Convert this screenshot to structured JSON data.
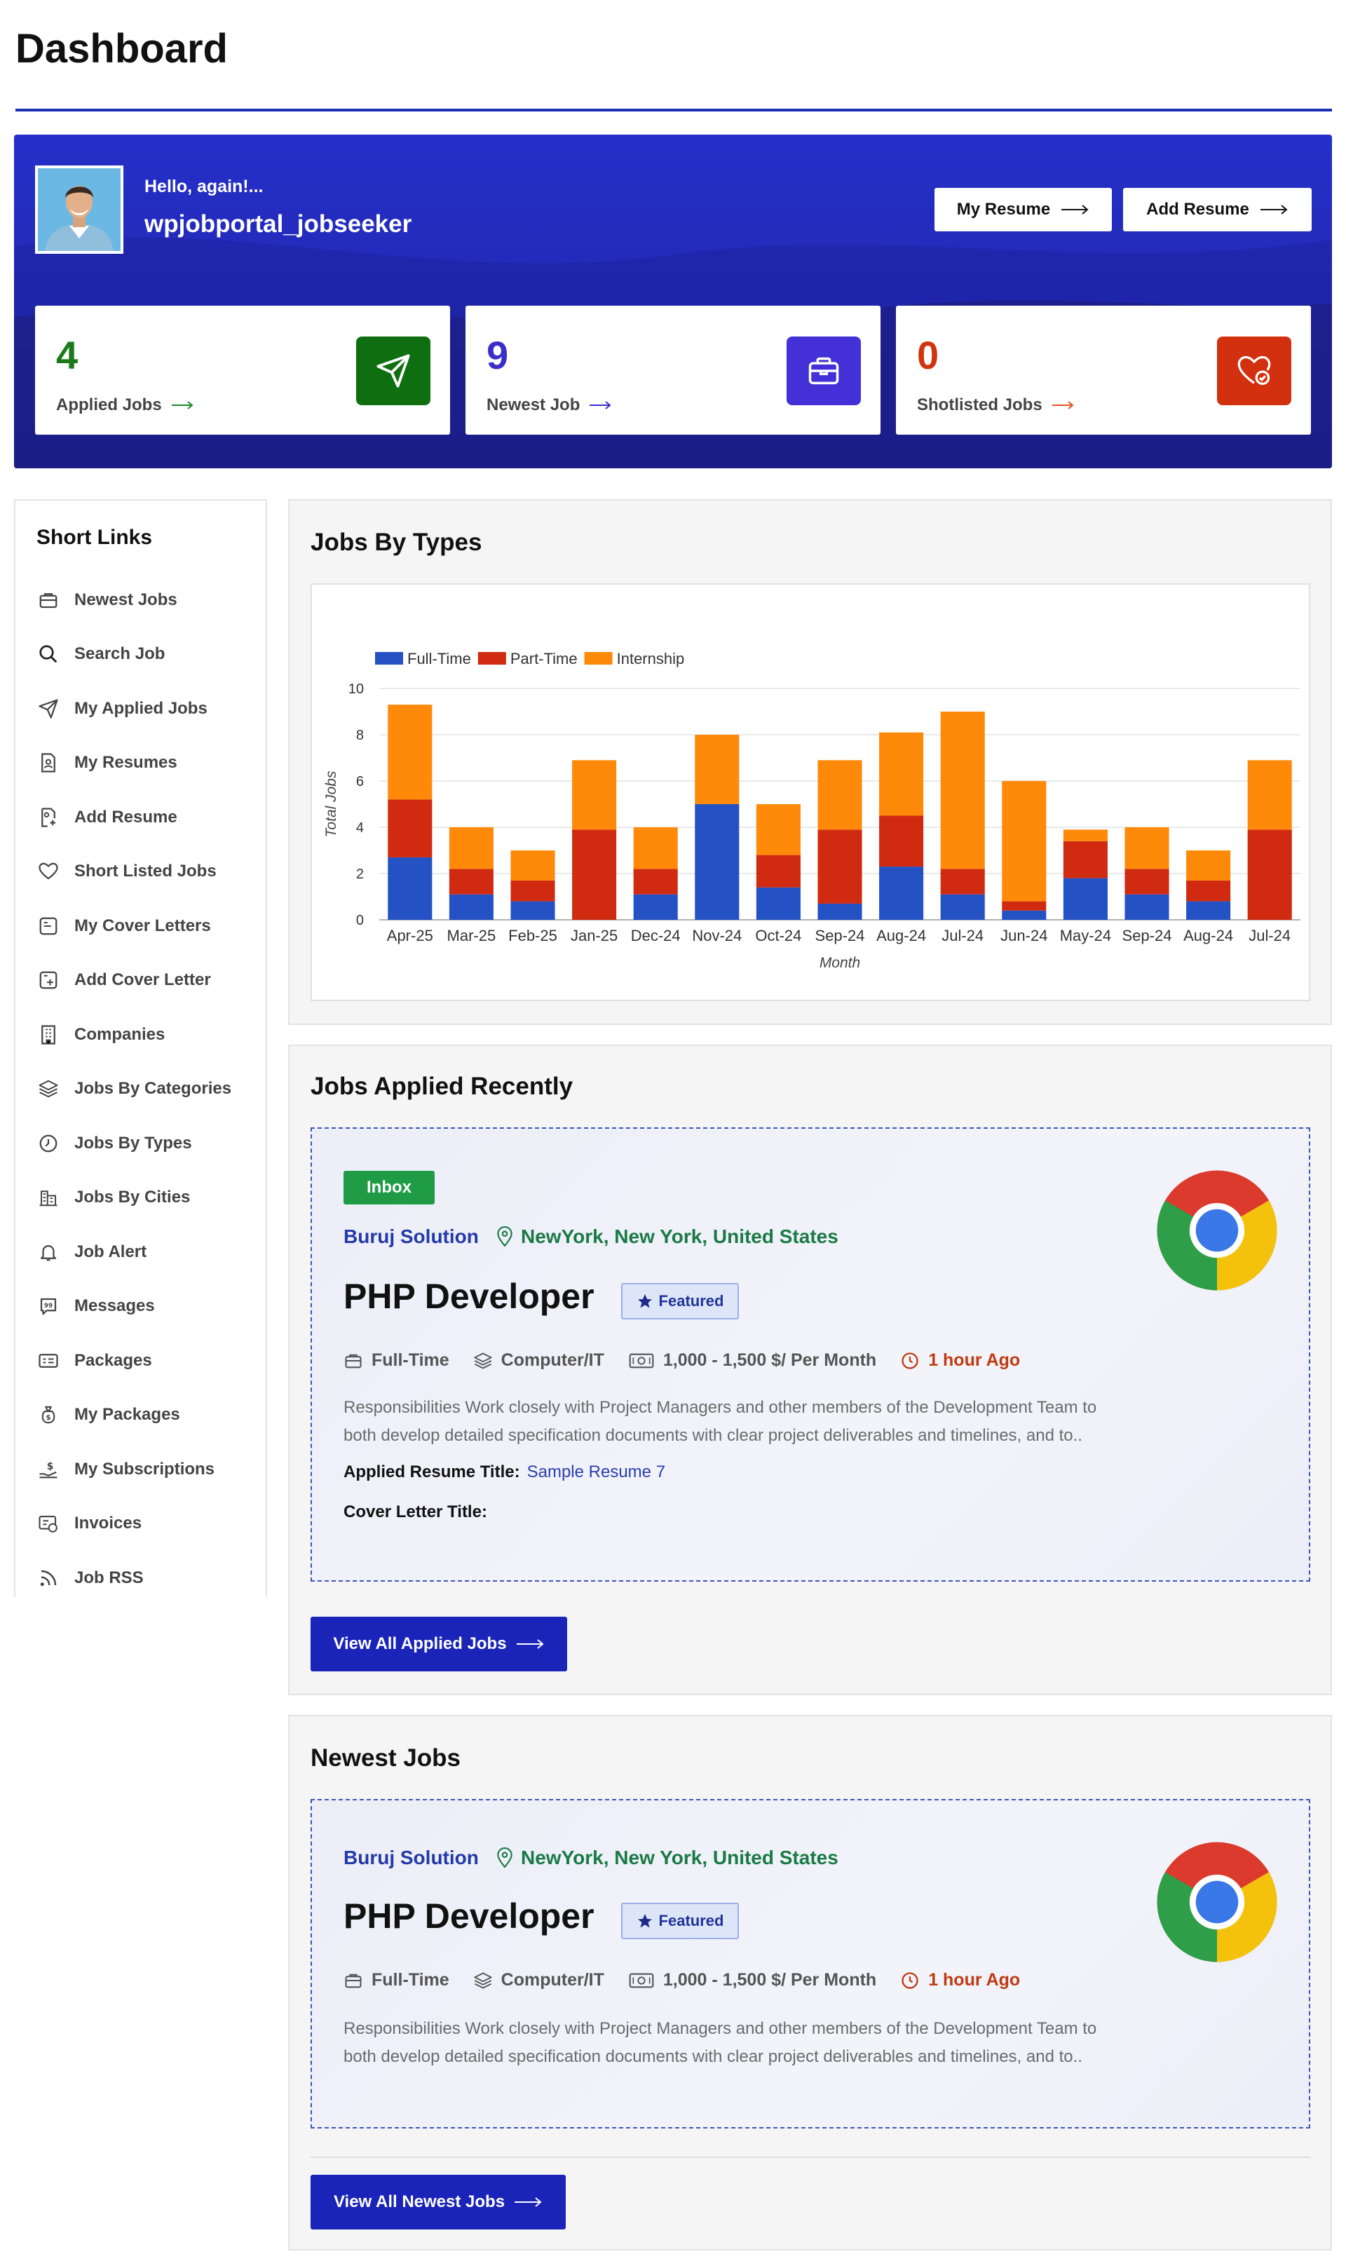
{
  "page": {
    "title": "Dashboard"
  },
  "hero": {
    "greeting": "Hello, again!...",
    "username": "wpjobportal_jobseeker",
    "buttons": {
      "my_resume": "My Resume",
      "add_resume": "Add Resume"
    },
    "stats": [
      {
        "value": "4",
        "label": "Applied Jobs",
        "color": "#1a7a1a",
        "icon": "paper-plane-icon",
        "icon_bg": "#0f6e0f"
      },
      {
        "value": "9",
        "label": "Newest Job",
        "color": "#3a2fc9",
        "icon": "briefcase-icon",
        "icon_bg": "#4330d6"
      },
      {
        "value": "0",
        "label": "Shotlisted Jobs",
        "color": "#d1350f",
        "icon": "heart-check-icon",
        "icon_bg": "#d2300e"
      }
    ]
  },
  "sidebar": {
    "title": "Short Links",
    "items": [
      {
        "label": "Newest Jobs",
        "icon": "briefcase-icon"
      },
      {
        "label": "Search Job",
        "icon": "search-icon"
      },
      {
        "label": "My Applied Jobs",
        "icon": "paper-plane-icon"
      },
      {
        "label": "My Resumes",
        "icon": "resume-icon"
      },
      {
        "label": "Add Resume",
        "icon": "add-resume-icon"
      },
      {
        "label": "Short Listed Jobs",
        "icon": "heart-icon"
      },
      {
        "label": "My Cover Letters",
        "icon": "cover-letter-icon"
      },
      {
        "label": "Add Cover Letter",
        "icon": "add-cover-letter-icon"
      },
      {
        "label": "Companies",
        "icon": "building-icon"
      },
      {
        "label": "Jobs By Categories",
        "icon": "layers-icon"
      },
      {
        "label": "Jobs By Types",
        "icon": "clock-icon"
      },
      {
        "label": "Jobs By Cities",
        "icon": "city-icon"
      },
      {
        "label": "Job Alert",
        "icon": "bell-icon"
      },
      {
        "label": "Messages",
        "icon": "message-icon"
      },
      {
        "label": "Packages",
        "icon": "package-icon"
      },
      {
        "label": "My Packages",
        "icon": "money-bag-icon"
      },
      {
        "label": "My Subscriptions",
        "icon": "subscription-icon"
      },
      {
        "label": "Invoices",
        "icon": "invoice-icon"
      },
      {
        "label": "Job RSS",
        "icon": "rss-icon"
      }
    ]
  },
  "jobs_by_types": {
    "title": "Jobs By Types"
  },
  "chart_data": {
    "type": "bar",
    "stacked": true,
    "categories": [
      "Apr-25",
      "Mar-25",
      "Feb-25",
      "Jan-25",
      "Dec-24",
      "Nov-24",
      "Oct-24",
      "Sep-24",
      "Aug-24",
      "Jul-24",
      "Jun-24",
      "May-24",
      "Sep-24",
      "Aug-24",
      "Jul-24"
    ],
    "series": [
      {
        "name": "Full-Time",
        "color": "#2451c4",
        "values": [
          2.7,
          1.1,
          0.8,
          0,
          1.1,
          5,
          1.4,
          0.7,
          2.3,
          1.1,
          0.4,
          1.8,
          1.1,
          0.8,
          0
        ]
      },
      {
        "name": "Part-Time",
        "color": "#d02a10",
        "values": [
          2.5,
          1.1,
          0.9,
          3.9,
          1.1,
          0,
          1.4,
          3.2,
          2.2,
          1.1,
          0.4,
          1.6,
          1.1,
          0.9,
          3.9
        ]
      },
      {
        "name": "Internship",
        "color": "#ff8a0a",
        "values": [
          4.1,
          1.8,
          1.3,
          3,
          1.8,
          3,
          2.2,
          3,
          3.6,
          6.8,
          5.2,
          0.5,
          1.8,
          1.3,
          3
        ]
      }
    ],
    "ylabel": "Total Jobs",
    "xlabel": "Month",
    "ylim": [
      0,
      10
    ],
    "yticks": [
      0,
      2,
      4,
      6,
      8,
      10
    ],
    "grid": true,
    "legend": "top-left"
  },
  "applied_recently": {
    "title": "Jobs Applied Recently",
    "status": "Inbox",
    "company": "Buruj Solution",
    "location": "NewYork, New York, United States",
    "job_title": "PHP Developer",
    "featured": "Featured",
    "job_type": "Full-Time",
    "category": "Computer/IT",
    "salary": "1,000 - 1,500 $/ Per Month",
    "posted": "1 hour Ago",
    "description_1": "Responsibilities Work closely with Project Managers and other members of the Development Team to",
    "description_2": "both develop detailed specification documents with clear project deliverables and timelines, and to..",
    "resume_label": "Applied Resume Title:",
    "resume_value": "Sample Resume 7",
    "cover_label": "Cover Letter Title:",
    "button": "View All Applied Jobs"
  },
  "newest_jobs": {
    "title": "Newest Jobs",
    "company": "Buruj Solution",
    "location": "NewYork, New York, United States",
    "job_title": "PHP Developer",
    "featured": "Featured",
    "job_type": "Full-Time",
    "category": "Computer/IT",
    "salary": "1,000 - 1,500 $/ Per Month",
    "posted": "1 hour Ago",
    "description_1": "Responsibilities Work closely with Project Managers and other members of the Development Team to",
    "description_2": "both develop detailed specification documents with clear project deliverables and timelines, and to..",
    "button": "View All Newest Jobs"
  }
}
